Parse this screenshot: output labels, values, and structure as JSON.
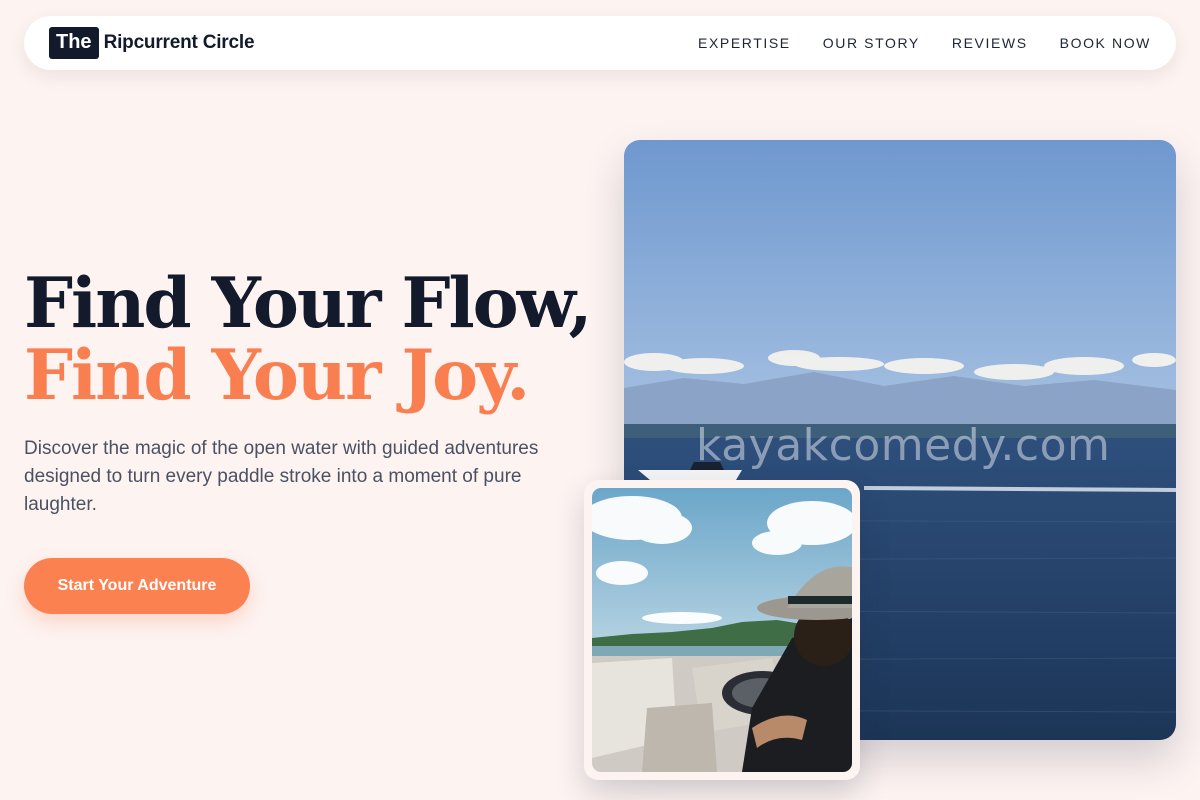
{
  "brand": {
    "badge": "The",
    "name": "Ripcurrent Circle"
  },
  "nav": {
    "items": [
      {
        "label": "EXPERTISE"
      },
      {
        "label": "OUR STORY"
      },
      {
        "label": "REVIEWS"
      },
      {
        "label": "BOOK NOW"
      }
    ]
  },
  "hero": {
    "title_line1": "Find Your Flow,",
    "title_line2": "Find Your Joy.",
    "description": "Discover the magic of the open water with guided adventures designed to turn every paddle stroke into a moment of pure laughter.",
    "cta_label": "Start Your Adventure"
  },
  "images": {
    "main_watermark": "kayakcomedy.com"
  },
  "colors": {
    "background": "#fdf3f1",
    "navy": "#121a2b",
    "accent": "#f97f51",
    "body_text": "#4a5163"
  }
}
